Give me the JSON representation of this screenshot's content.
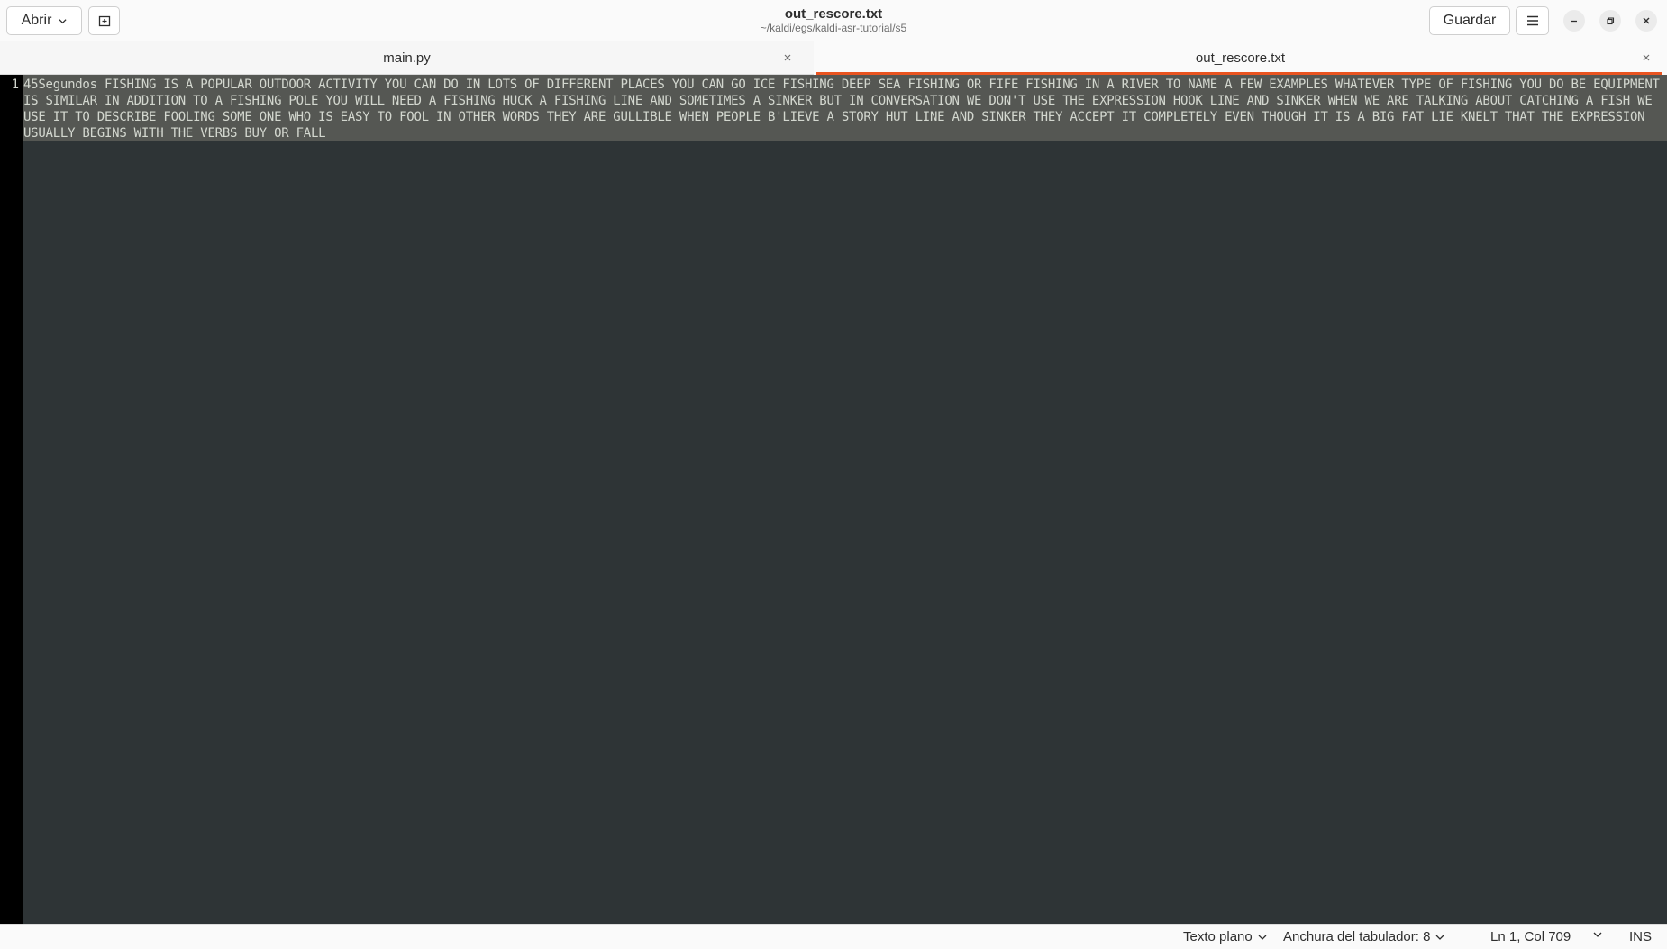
{
  "header": {
    "open_label": "Abrir",
    "save_label": "Guardar",
    "title": "out_rescore.txt",
    "subtitle": "~/kaldi/egs/kaldi-asr-tutorial/s5"
  },
  "tabs": [
    {
      "label": "main.py",
      "active": false
    },
    {
      "label": "out_rescore.txt",
      "active": true
    }
  ],
  "editor": {
    "line_numbers": [
      "1"
    ],
    "content": "45Segundos FISHING IS A POPULAR OUTDOOR ACTIVITY YOU CAN DO IN LOTS OF DIFFERENT PLACES YOU CAN GO ICE FISHING DEEP SEA FISHING OR FIFE FISHING IN A RIVER TO NAME A FEW EXAMPLES WHATEVER TYPE OF FISHING YOU DO BE EQUIPMENT IS SIMILAR IN ADDITION TO A FISHING POLE YOU WILL NEED A FISHING HUCK A FISHING LINE AND SOMETIMES A SINKER BUT IN CONVERSATION WE DON'T USE THE EXPRESSION HOOK LINE AND SINKER WHEN WE ARE TALKING ABOUT CATCHING A FISH WE USE IT TO DESCRIBE FOOLING SOME ONE WHO IS EASY TO FOOL IN OTHER WORDS THEY ARE GULLIBLE WHEN PEOPLE B'LIEVE A STORY HUT LINE AND SINKER THEY ACCEPT IT COMPLETELY EVEN THOUGH IT IS A BIG FAT LIE KNELT THAT THE EXPRESSION USUALLY BEGINS WITH THE VERBS BUY OR FALL"
  },
  "status": {
    "language": "Texto plano",
    "tab_width": "Anchura del tabulador: 8",
    "position": "Ln 1, Col 709",
    "mode": "INS"
  },
  "colors": {
    "accent": "#e95420",
    "editor_bg": "#2e3436",
    "current_line": "#555753",
    "gutter_bg": "#000000",
    "editor_text": "#d3d7cf"
  }
}
